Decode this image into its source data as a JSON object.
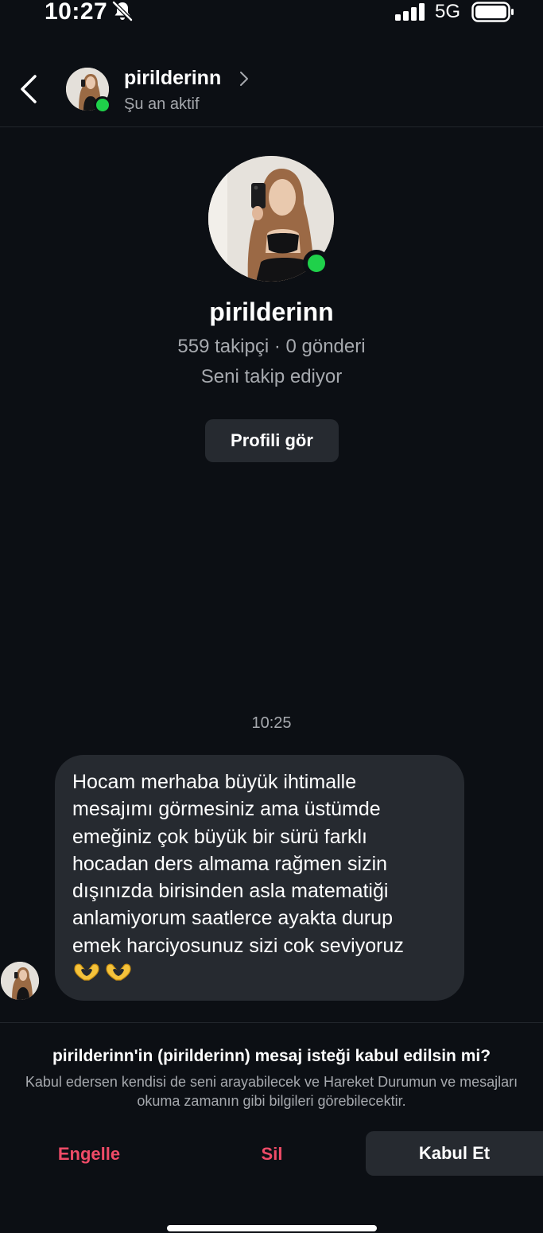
{
  "status_bar": {
    "time": "10:27",
    "network": "5G",
    "icons": [
      "bell-off-icon",
      "signal-icon",
      "battery-icon"
    ]
  },
  "header": {
    "back_icon": "chevron-left-icon",
    "username": "pirilderinn",
    "chevron_icon": "chevron-right-icon",
    "status": "Şu an aktif"
  },
  "profile": {
    "name": "pirilderinn",
    "stats": "559 takipçi · 0 gönderi",
    "follow_status": "Seni takip ediyor",
    "view_profile_label": "Profili gör"
  },
  "conversation": {
    "timestamp": "10:25",
    "message": "Hocam merhaba büyük ihtimalle\nmesajımı görmesiniz ama üstümde\nemeğiniz çok büyük bir sürü farklı\nhocadan ders almama rağmen sizin\ndışınızda birisinden asla matematiği\nanlamiyorum saatlerce ayakta durup\nemek harciyosunuz sizi cok seviyoruz",
    "emojis": [
      "heart-hands-icon",
      "heart-hands-icon"
    ]
  },
  "request": {
    "title": "pirilderinn'in (pirilderinn) mesaj isteği kabul edilsin mi?",
    "description": "Kabul edersen kendisi de seni arayabilecek ve Hareket Durumun ve mesajları okuma zamanın gibi bilgileri görebilecektir.",
    "block_label": "Engelle",
    "delete_label": "Sil",
    "accept_label": "Kabul Et"
  },
  "colors": {
    "background": "#0c0f14",
    "surface": "#262a30",
    "online": "#1fd14a",
    "destructive": "#ef4b67",
    "secondary_text": "#a6a9ae"
  }
}
